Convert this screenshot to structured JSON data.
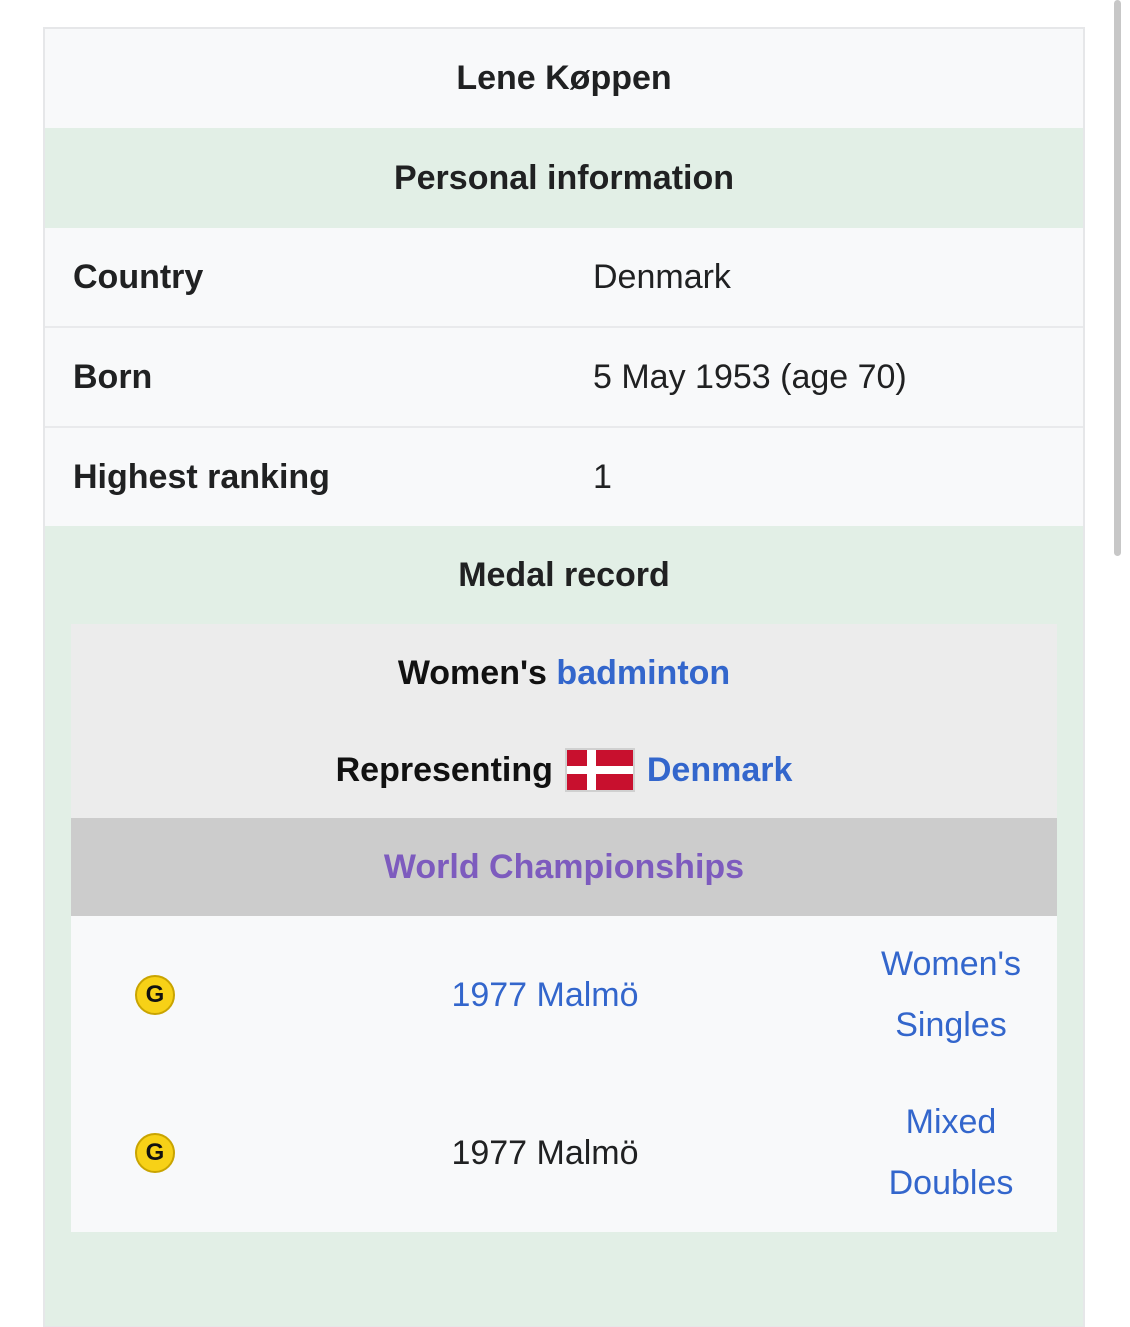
{
  "infobox": {
    "title": "Lene Køppen",
    "personal_heading": "Personal information",
    "rows": [
      {
        "label": "Country",
        "value": "Denmark"
      },
      {
        "label": "Born",
        "value": "5 May 1953 (age 70)"
      },
      {
        "label": "Highest ranking",
        "value": "1"
      }
    ],
    "medal_heading": "Medal record",
    "sport_prefix": "Women's",
    "sport_link": "badminton",
    "representing_label": "Representing",
    "country_link": "Denmark",
    "competition": "World Championships",
    "medals": [
      {
        "medal": "G",
        "event": "1977 Malmö",
        "category_line1": "Women's",
        "category_line2": "Singles"
      },
      {
        "medal": "G",
        "event": "1977 Malmö",
        "category_line1": "Mixed",
        "category_line2": "Doubles"
      }
    ]
  },
  "colors": {
    "section_bg": "#e2efe6",
    "link": "#3366cc",
    "competition_text": "#7d5bbe",
    "gold_medal": "#f7d117",
    "flag_red": "#c8102e"
  },
  "icons": [
    "gold-medal-icon",
    "denmark-flag-icon"
  ]
}
